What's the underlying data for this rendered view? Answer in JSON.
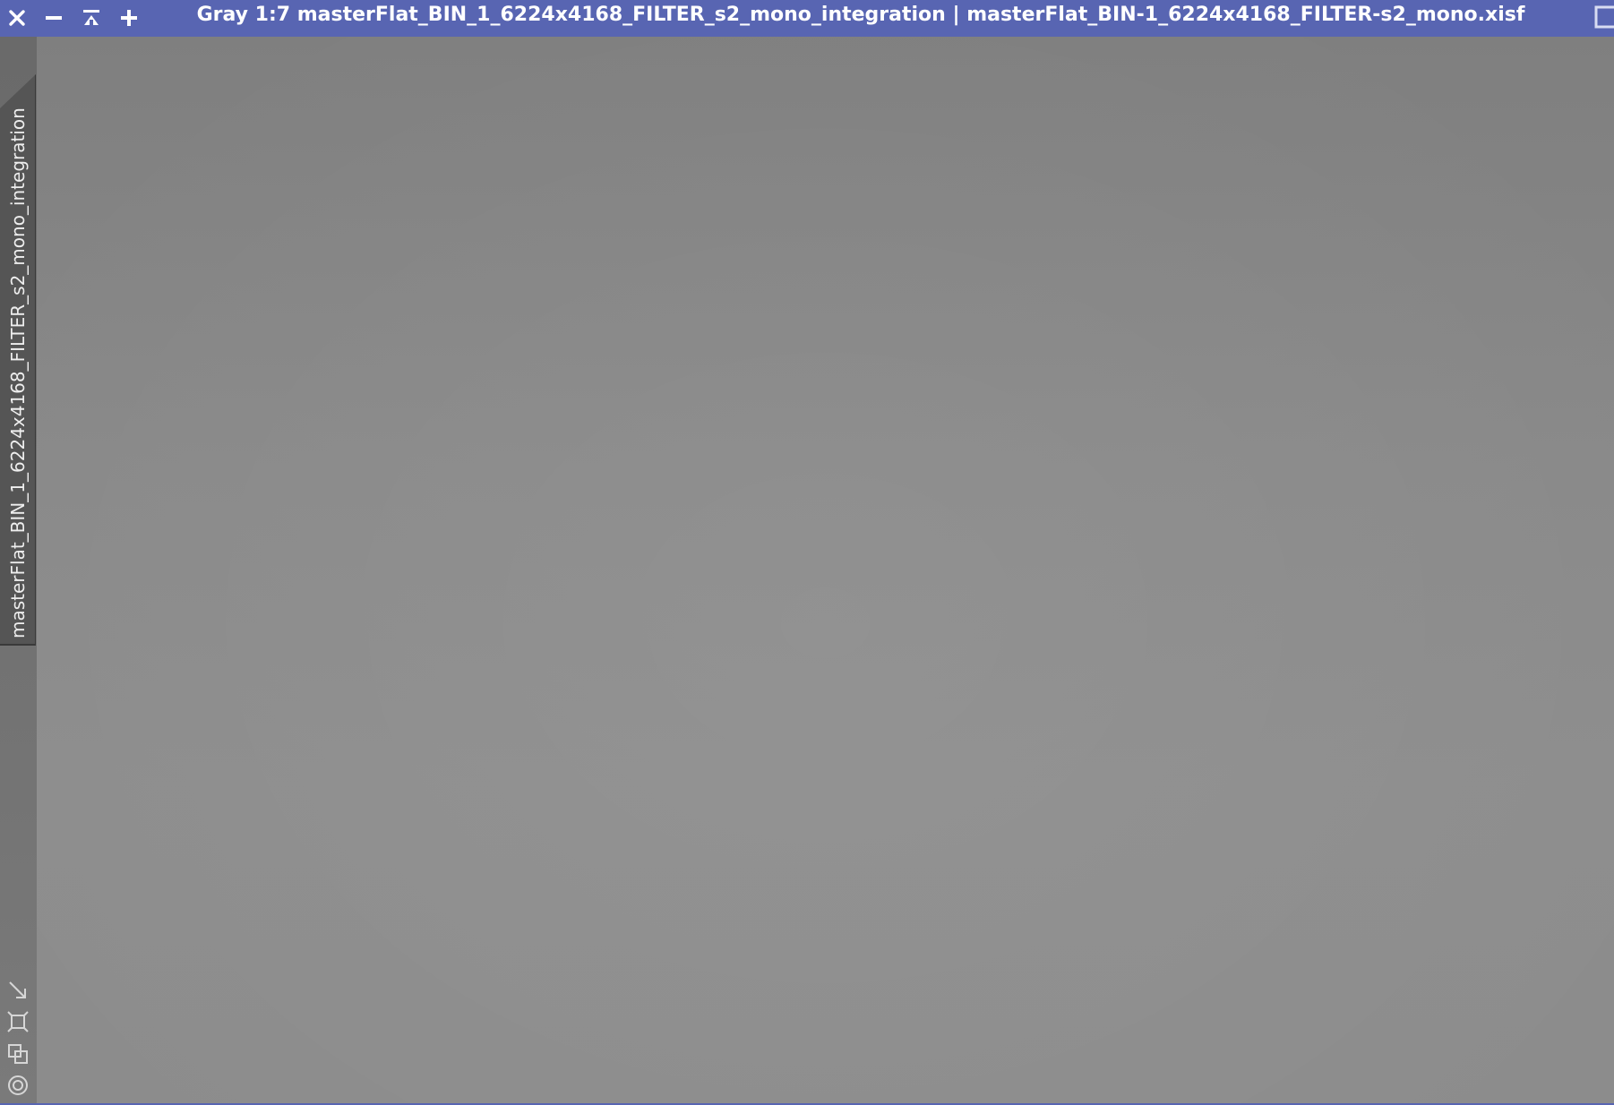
{
  "window": {
    "title": "Gray 1:7 masterFlat_BIN_1_6224x4168_FILTER_s2_mono_integration | masterFlat_BIN-1_6224x4168_FILTER-s2_mono.xisf",
    "accent_color": "#5865b2",
    "image_background_color": "#888888"
  },
  "titlebar_buttons": [
    {
      "name": "close",
      "icon": "close-icon"
    },
    {
      "name": "minimize",
      "icon": "minus-icon"
    },
    {
      "name": "shade",
      "icon": "collapse-up-icon"
    },
    {
      "name": "maximize",
      "icon": "plus-icon"
    }
  ],
  "identifier_tab": {
    "label": "masterFlat_BIN_1_6224x4168_FILTER_s2_mono_integration"
  },
  "side_tools": [
    {
      "name": "zoom-to-fit",
      "icon": "arrow-diagonal-icon"
    },
    {
      "name": "fit-view",
      "icon": "frame-icon"
    },
    {
      "name": "clone-view",
      "icon": "duplicate-icon"
    },
    {
      "name": "target",
      "icon": "target-icon"
    }
  ]
}
